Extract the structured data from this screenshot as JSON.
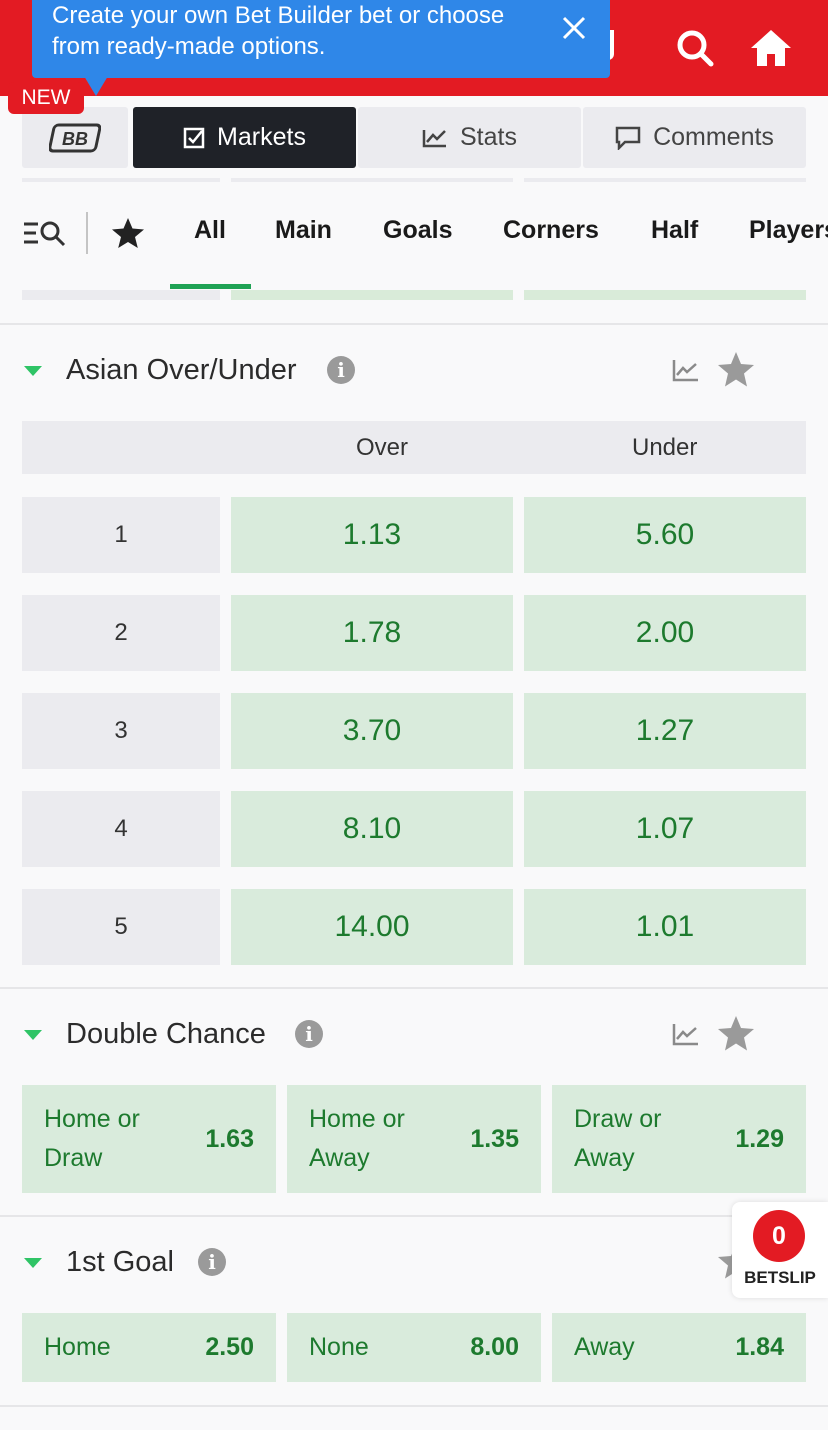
{
  "header": {
    "search_icon": "search-icon",
    "home_icon": "home-icon",
    "color": "#e31b23"
  },
  "tooltip": {
    "line1": "Create your own Bet Builder bet or choose",
    "line2": "from ready-made options.",
    "badge": "NEW"
  },
  "tabs": [
    {
      "label": "BB",
      "icon": "bet-builder-icon"
    },
    {
      "label": "Markets",
      "icon": "checkbox-icon"
    },
    {
      "label": "Stats",
      "icon": "chart-icon"
    },
    {
      "label": "Comments",
      "icon": "comment-icon"
    }
  ],
  "filters": [
    "All",
    "Main",
    "Goals",
    "Corners",
    "Half",
    "Players"
  ],
  "asian": {
    "title": "Asian Over/Under",
    "col_over": "Over",
    "col_under": "Under",
    "rows": [
      {
        "line": "1",
        "over": "1.13",
        "under": "5.60"
      },
      {
        "line": "2",
        "over": "1.78",
        "under": "2.00"
      },
      {
        "line": "3",
        "over": "3.70",
        "under": "1.27"
      },
      {
        "line": "4",
        "over": "8.10",
        "under": "1.07"
      },
      {
        "line": "5",
        "over": "14.00",
        "under": "1.01"
      }
    ]
  },
  "double_chance": {
    "title": "Double Chance",
    "options": [
      {
        "line1": "Home or",
        "line2": "Draw",
        "price": "1.63"
      },
      {
        "line1": "Home or",
        "line2": "Away",
        "price": "1.35"
      },
      {
        "line1": "Draw or",
        "line2": "Away",
        "price": "1.29"
      }
    ]
  },
  "first_goal": {
    "title": "1st Goal",
    "options": [
      {
        "label": "Home",
        "price": "2.50"
      },
      {
        "label": "None",
        "price": "8.00"
      },
      {
        "label": "Away",
        "price": "1.84"
      }
    ]
  },
  "betslip": {
    "count": "0",
    "label": "BETSLIP"
  },
  "info_glyph": "i",
  "colors": {
    "accent": "#1fa254",
    "odds_bg": "#d9ebdc",
    "odds_text": "#1d7a2e",
    "tooltip": "#2f87e8"
  }
}
